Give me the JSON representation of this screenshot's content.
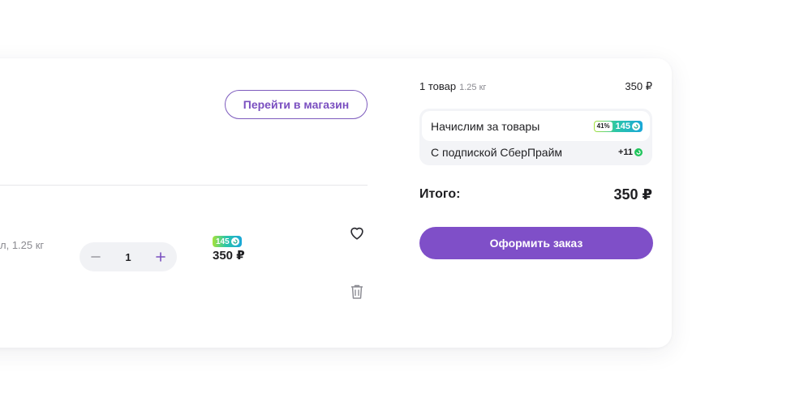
{
  "store": {
    "go_to_store_label": "Перейти в магазин"
  },
  "item": {
    "weight_prefix": "л,",
    "weight": "1.25 кг",
    "quantity": "1",
    "bonus": "145",
    "price": "350 ₽"
  },
  "summary": {
    "count_label": "1 товар",
    "count_weight": "1.25 кг",
    "subtotal": "350 ₽",
    "accrue_label": "Начислим за товары",
    "accrue_percent": "41%",
    "accrue_bonus": "145",
    "subscription_label": "С подпиской СберПрайм",
    "subscription_bonus": "+11",
    "total_label": "Итого:",
    "total_value": "350 ₽",
    "checkout_label": "Оформить заказ"
  },
  "colors": {
    "accent": "#7f4fc8",
    "bonus_gradient_start": "#a6e23a",
    "bonus_gradient_end": "#1aa7d8",
    "sberprime_green": "#21c55d"
  },
  "icons": [
    "minus-icon",
    "plus-icon",
    "heart-icon",
    "trash-icon",
    "bonus-coin-icon"
  ]
}
